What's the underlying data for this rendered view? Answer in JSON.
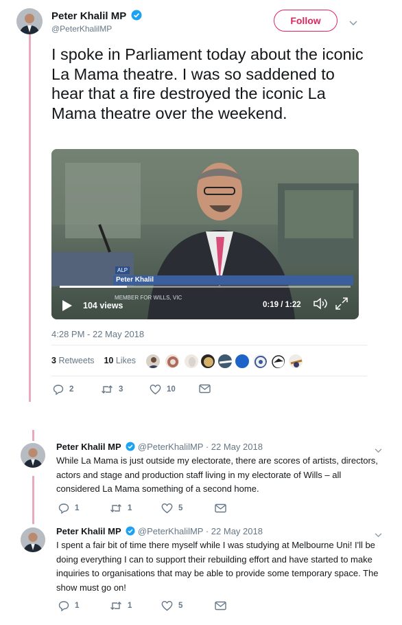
{
  "main_tweet": {
    "display_name": "Peter Khalil MP",
    "handle": "@PeterKhalilMP",
    "follow_label": "Follow",
    "text": "I spoke in Parliament today about the iconic La Mama theatre. I was so saddened to hear that a fire destroyed the iconic La Mama theatre over the weekend.",
    "video": {
      "party_tag": "ALP",
      "lower_third_name": "Peter Khalil",
      "lower_third_title": "MEMBER FOR WILLS, VIC",
      "views": "104 views",
      "time": "0:19 / 1:22",
      "progress": 0.23
    },
    "timestamp": "4:28 PM - 22 May 2018",
    "retweets_count": "3",
    "retweets_label": "Retweets",
    "likes_count": "10",
    "likes_label": "Likes",
    "actions": {
      "replies": "2",
      "retweets": "3",
      "likes": "10"
    }
  },
  "replies": [
    {
      "display_name": "Peter Khalil MP",
      "handle": "@PeterKhalilMP",
      "date": "· 22 May 2018",
      "text": "While La Mama is just outside my electorate, there are scores of artists, directors, actors and stage and production staff living in my electorate of Wills – all considered La Mama something of a second home.",
      "replies": "1",
      "retweets": "1",
      "likes": "5"
    },
    {
      "display_name": "Peter Khalil MP",
      "handle": "@PeterKhalilMP",
      "date": "· 22 May 2018",
      "text": "I spent a fair bit of time there myself while I was studying at Melbourne Uni! I'll be doing everything I can to support their rebuilding effort and have started to make inquiries to organisations that may be able to provide some temporary space. The show must go on!",
      "replies": "1",
      "retweets": "1",
      "likes": "5"
    }
  ],
  "colors": {
    "accent": "#e0245e",
    "thread_line": "#e8a9bd",
    "verified": "#1da1f2",
    "muted": "#657786"
  }
}
